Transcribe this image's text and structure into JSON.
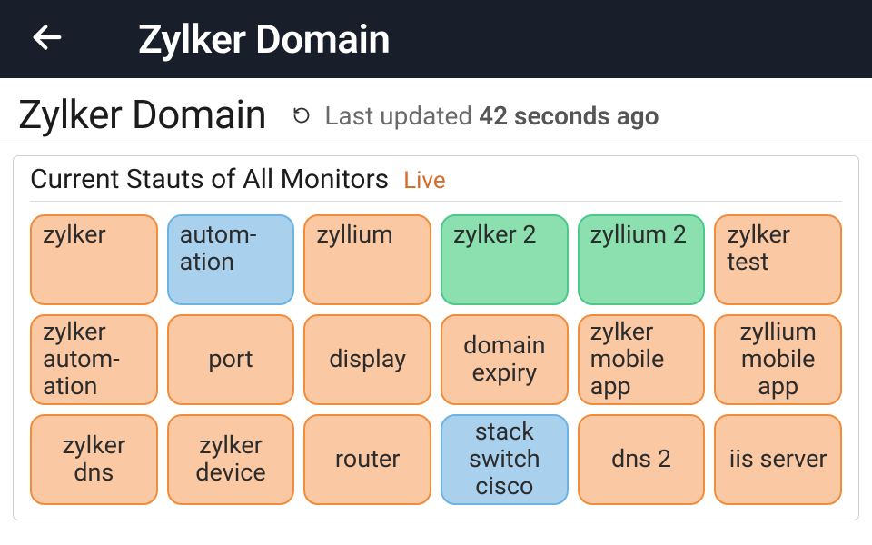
{
  "topbar": {
    "title": "Zylker Domain"
  },
  "page": {
    "title": "Zylker Domain",
    "updated_prefix": "Last updated ",
    "updated_value": "42 seconds ago"
  },
  "card": {
    "title": "Current Stauts of All Monitors",
    "live_label": "Live"
  },
  "monitors": [
    {
      "label": "zylker",
      "status": "orange",
      "row": 1,
      "align": "start"
    },
    {
      "label": "autom-ation",
      "status": "blue",
      "row": 1,
      "align": "start"
    },
    {
      "label": "zyllium",
      "status": "orange",
      "row": 1,
      "align": "start"
    },
    {
      "label": "zylker 2",
      "status": "green",
      "row": 1,
      "align": "start"
    },
    {
      "label": "zyllium 2",
      "status": "green",
      "row": 1,
      "align": "start"
    },
    {
      "label": "zylker test",
      "status": "orange",
      "row": 1,
      "align": "start"
    },
    {
      "label": "zylker autom-ation",
      "status": "orange",
      "row": 2,
      "align": "start"
    },
    {
      "label": "port",
      "status": "orange",
      "row": 2,
      "align": "center"
    },
    {
      "label": "display",
      "status": "orange",
      "row": 2,
      "align": "center"
    },
    {
      "label": "domain expiry",
      "status": "orange",
      "row": 2,
      "align": "center"
    },
    {
      "label": "zylker mobile app",
      "status": "orange",
      "row": 2,
      "align": "start"
    },
    {
      "label": "zyllium mobile app",
      "status": "orange",
      "row": 2,
      "align": "center"
    },
    {
      "label": "zylker dns",
      "status": "orange",
      "row": 3,
      "align": "center"
    },
    {
      "label": "zylker device",
      "status": "orange",
      "row": 3,
      "align": "center"
    },
    {
      "label": "router",
      "status": "orange",
      "row": 3,
      "align": "center"
    },
    {
      "label": "stack switch cisco",
      "status": "blue",
      "row": 3,
      "align": "center"
    },
    {
      "label": "dns 2",
      "status": "orange",
      "row": 3,
      "align": "center"
    },
    {
      "label": "iis server",
      "status": "orange",
      "row": 3,
      "align": "center"
    }
  ],
  "status_colors": {
    "orange": {
      "fill": "#fac8a3",
      "border": "#f08c3a"
    },
    "blue": {
      "fill": "#a9d1ee",
      "border": "#6bb3e0"
    },
    "green": {
      "fill": "#8ce0b0",
      "border": "#4cc88a"
    }
  }
}
